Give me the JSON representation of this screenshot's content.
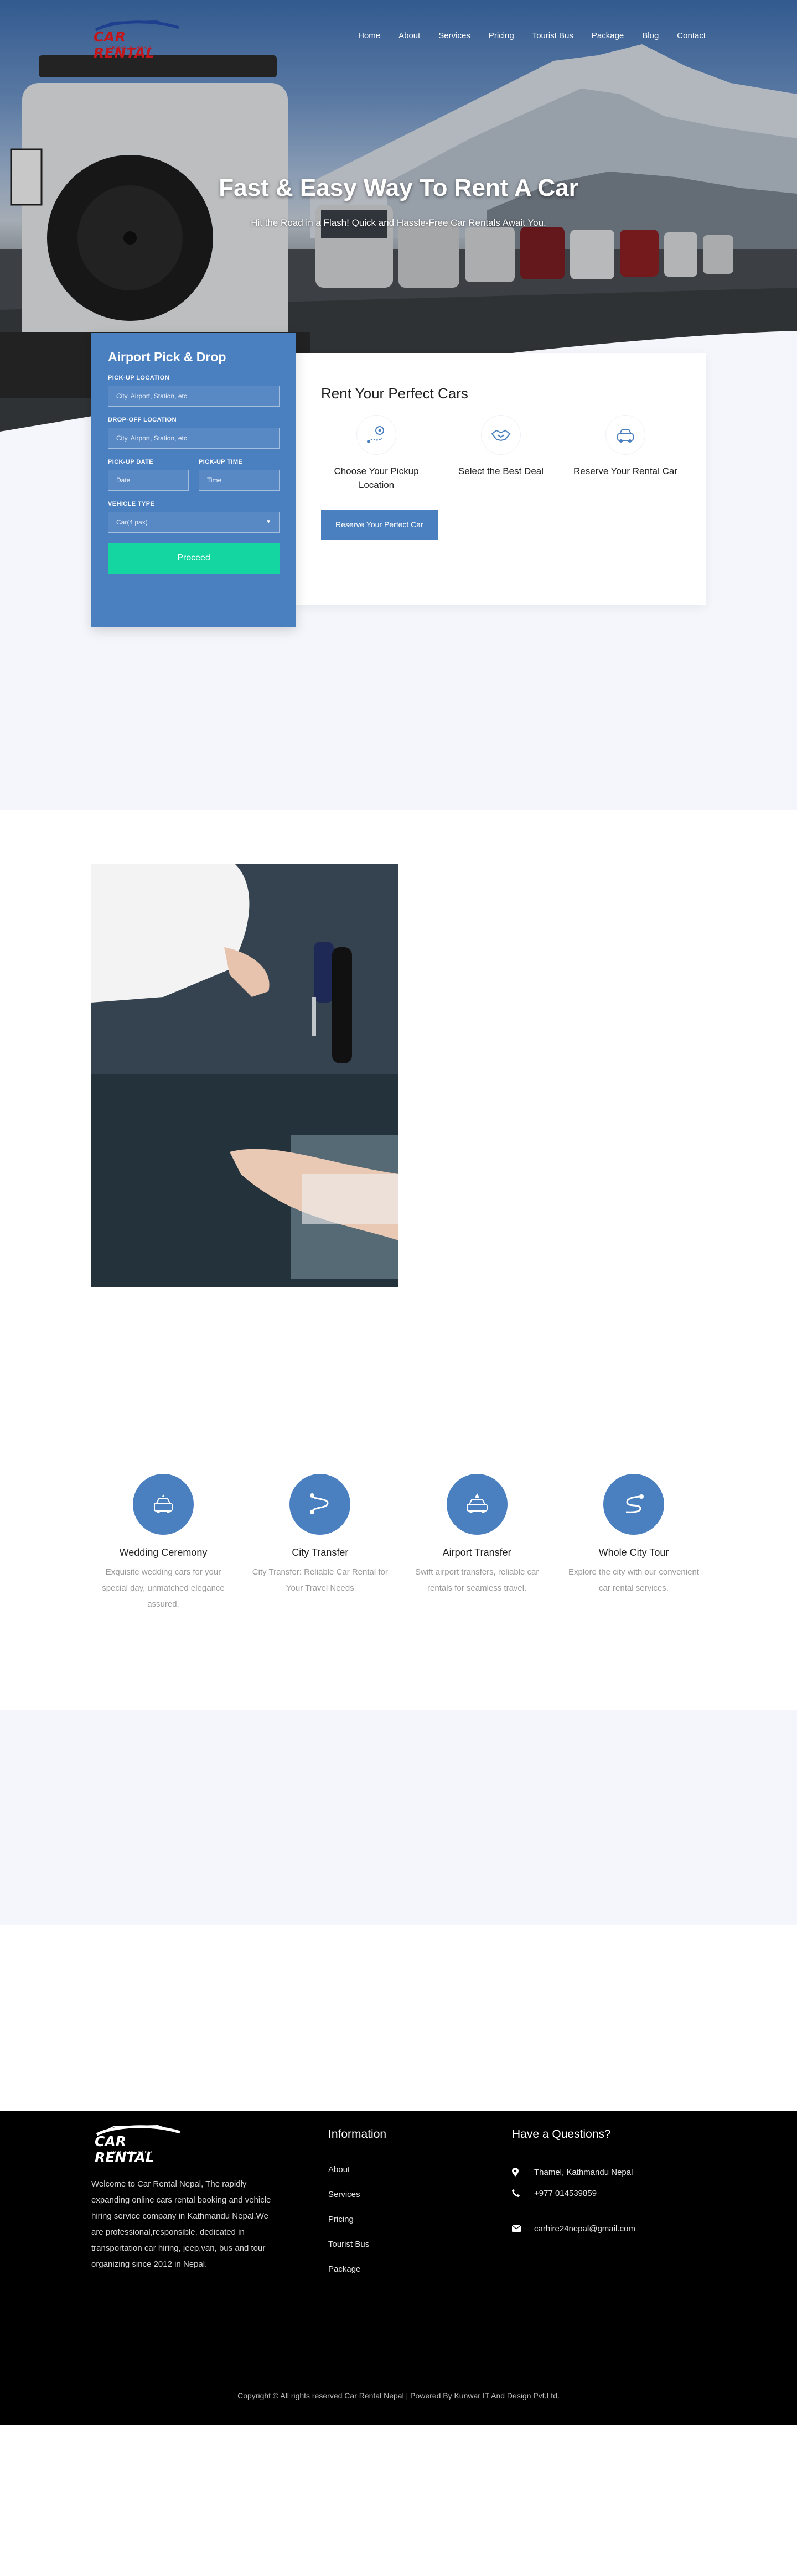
{
  "brand": {
    "name": "CAR RENTAL",
    "tagline": "CAR RENTAL NEPAL",
    "accent": "#4a7fc0",
    "logo_red": "#c3161b",
    "proceed_green": "#14d6a0"
  },
  "nav": {
    "items": [
      {
        "label": "Home"
      },
      {
        "label": "About"
      },
      {
        "label": "Services"
      },
      {
        "label": "Pricing"
      },
      {
        "label": "Tourist Bus"
      },
      {
        "label": "Package"
      },
      {
        "label": "Blog"
      },
      {
        "label": "Contact"
      }
    ]
  },
  "hero": {
    "title": "Fast & Easy Way To Rent A Car",
    "subtitle": "Hit the Road in a Flash! Quick and Hassle-Free Car Rentals Await You."
  },
  "booking": {
    "title": "Airport Pick & Drop",
    "pickup_label": "PICK-UP LOCATION",
    "pickup_placeholder": "City, Airport, Station, etc",
    "dropoff_label": "DROP-OFF LOCATION",
    "dropoff_placeholder": "City, Airport, Station, etc",
    "date_label": "PICK-UP DATE",
    "date_placeholder": "Date",
    "time_label": "PICK-UP TIME",
    "time_placeholder": "Time",
    "vehicle_label": "VEHICLE TYPE",
    "vehicle_selected": "Car(4 pax)",
    "proceed_label": "Proceed"
  },
  "rent": {
    "title": "Rent Your Perfect Cars",
    "steps": [
      {
        "label": "Choose Your Pickup Location",
        "icon": "location-route-icon"
      },
      {
        "label": "Select the Best Deal",
        "icon": "handshake-icon"
      },
      {
        "label": "Reserve Your Rental Car",
        "icon": "car-reserve-icon"
      }
    ],
    "button_label": "Reserve Your Perfect Car"
  },
  "services": [
    {
      "title": "Wedding Ceremony",
      "desc": "Exquisite wedding cars for your special day, unmatched elegance assured.",
      "icon": "wedding-car-icon"
    },
    {
      "title": "City Transfer",
      "desc": "City Transfer: Reliable Car Rental for Your Travel Needs",
      "icon": "city-route-icon"
    },
    {
      "title": "Airport Transfer",
      "desc": "Swift airport transfers, reliable car rentals for seamless travel.",
      "icon": "airport-car-icon"
    },
    {
      "title": "Whole City Tour",
      "desc": "Explore the city with our convenient car rental services.",
      "icon": "city-tour-icon"
    }
  ],
  "footer": {
    "about": "Welcome to Car Rental Nepal, The rapidly expanding online cars rental booking and vehicle hiring service company in Kathmandu Nepal.We are professional,responsible, dedicated in transportation car hiring, jeep,van, bus and tour organizing since 2012 in Nepal.",
    "info_title": "Information",
    "info_links": [
      {
        "label": "About"
      },
      {
        "label": "Services"
      },
      {
        "label": "Pricing"
      },
      {
        "label": "Tourist Bus"
      },
      {
        "label": "Package"
      }
    ],
    "questions_title": "Have a Questions?",
    "address": "Thamel, Kathmandu Nepal",
    "phone": "+977 014539859",
    "email": "carhire24nepal@gmail.com",
    "copyright": "Copyright © All rights reserved Car Rental Nepal | Powered By Kunwar IT And Design Pvt.Ltd."
  }
}
